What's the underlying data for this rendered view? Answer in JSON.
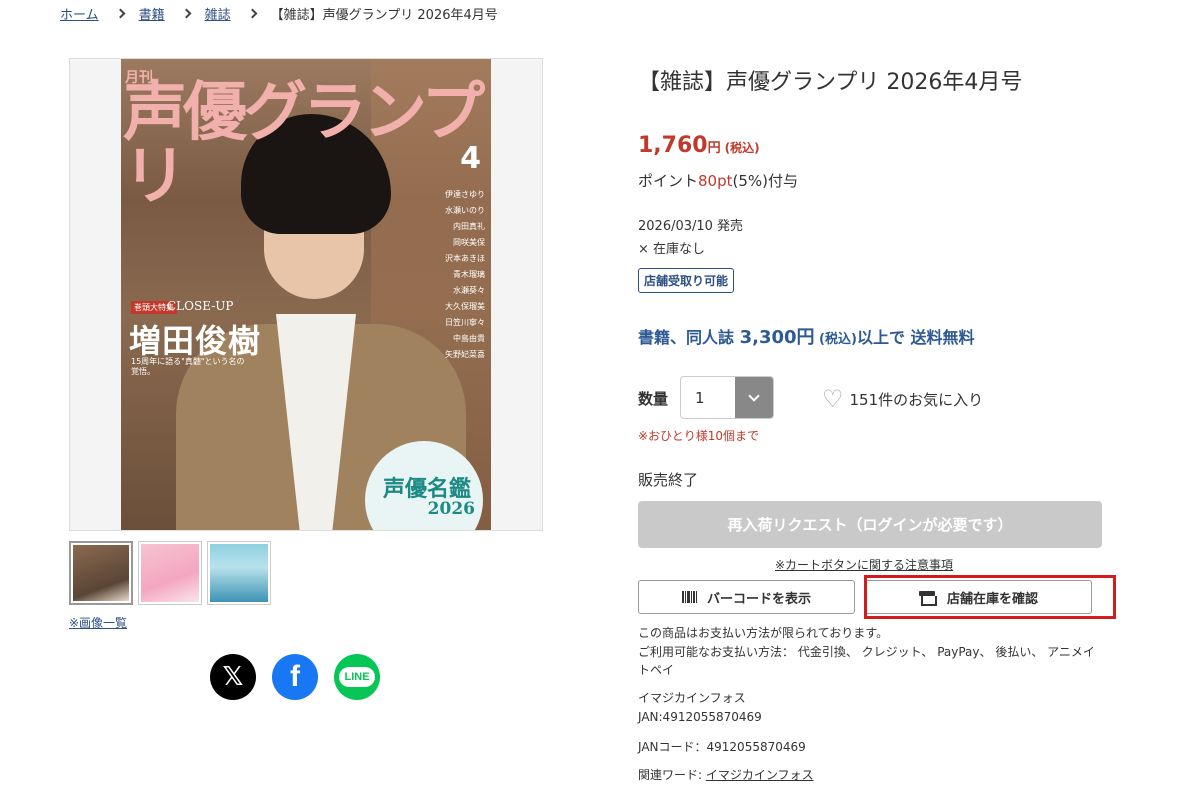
{
  "breadcrumb": {
    "items": [
      "ホーム",
      "書籍",
      "雑誌"
    ],
    "current": "【雑誌】声優グランプリ 2026年4月号"
  },
  "cover": {
    "logo_small": "月刊",
    "logo": "声優グランプリ",
    "issue": "4",
    "tag": "巻頭大特集",
    "closeup": "CLOSE-UP",
    "name": "増田俊樹",
    "sub": "15周年に語る\"真髄\"という名の覚悟。",
    "circle_title": "声優名鑑",
    "circle_year": "2026",
    "list": [
      "伊達さゆり",
      "水瀬いのり",
      "内田真礼",
      "岡咲美保",
      "沢本あきほ",
      "青木瑠璃",
      "水瀬葵々",
      "大久保瑠美",
      "日笠川寧々",
      "中島由貴",
      "矢野妃菜喜"
    ]
  },
  "thumbnails": [
    "cover-front",
    "cover-pink",
    "cover-meikan"
  ],
  "image_list_link": "※画像一覧",
  "share": {
    "x": "𝕏",
    "facebook": "f",
    "line": "LINE"
  },
  "product": {
    "title": "【雑誌】声優グランプリ 2026年4月号",
    "price": "1,760",
    "price_unit": "円",
    "price_tax": "(税込)",
    "points_prefix": "ポイント",
    "points_value": "80pt",
    "points_suffix": "(5%)付与",
    "release": "2026/03/10 発売",
    "stock": "× 在庫なし",
    "store_badge": "店舗受取り可能",
    "shipping_prefix": "書籍、同人誌 ",
    "shipping_amount": "3,300円",
    "shipping_tax": " (税込)",
    "shipping_suffix": "以上で 送料無料"
  },
  "quantity": {
    "label": "数量",
    "value": "1",
    "limit": "※おひとり様10個まで"
  },
  "favorite": {
    "text": "151件のお気に入り"
  },
  "status": {
    "sold_out": "販売終了",
    "restock_button": "再入荷リクエスト（ログインが必要です）",
    "cart_notice": "※カートボタンに関する注意事項"
  },
  "buttons": {
    "barcode": "バーコードを表示",
    "store_stock": "店舗在庫を確認"
  },
  "payment": {
    "line1": "この商品はお支払い方法が限られております。",
    "line2": "ご利用可能なお支払い方法： 代金引換、 クレジット、 PayPay、 後払い、 アニメイトペイ"
  },
  "maker": {
    "name": "イマジカインフォス",
    "jan": "JAN:4912055870469"
  },
  "jan_code": "JANコード：4912055870469",
  "keywords": {
    "label": "関連ワード: ",
    "value": "イマジカインフォス"
  },
  "colors": {
    "price_red": "#c0392b",
    "link_blue": "#2e4f86",
    "shipping_blue": "#2e5a94",
    "highlight_red": "#d21d1d",
    "disabled_gray": "#c9c9c9"
  }
}
